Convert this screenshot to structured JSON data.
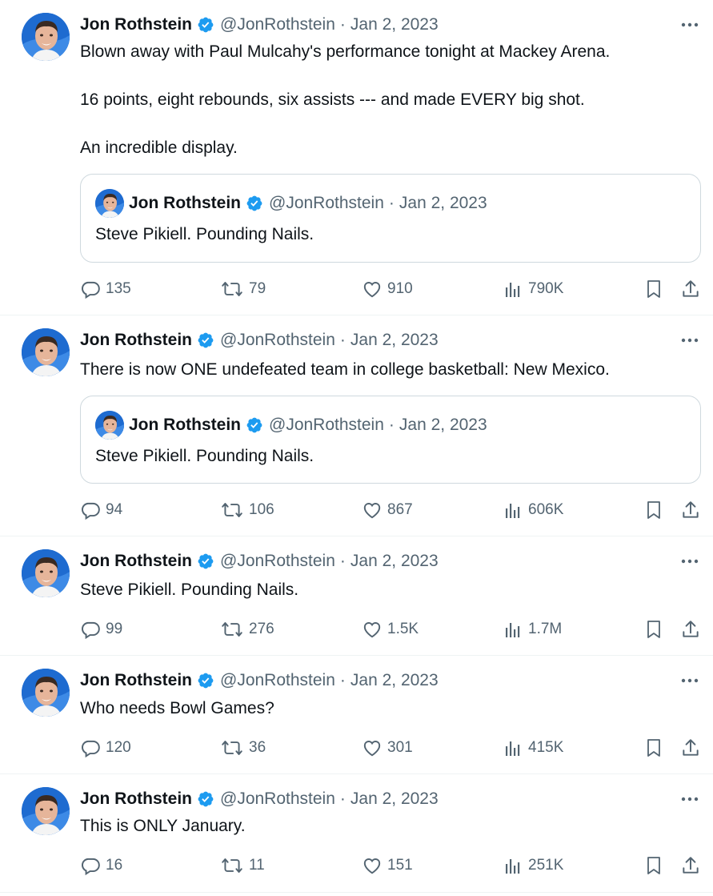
{
  "tweets": [
    {
      "name": "Jon Rothstein",
      "handle": "@JonRothstein",
      "dot": "·",
      "date": "Jan 2, 2023",
      "text": "Blown away with Paul Mulcahy's performance tonight at Mackey Arena.\n\n16 points, eight rebounds, six assists --- and made EVERY big shot.\n\nAn incredible display.",
      "quote": {
        "name": "Jon Rothstein",
        "handle": "@JonRothstein",
        "dot": "·",
        "date": "Jan 2, 2023",
        "text": "Steve Pikiell. Pounding Nails."
      },
      "replies": "135",
      "retweets": "79",
      "likes": "910",
      "views": "790K"
    },
    {
      "name": "Jon Rothstein",
      "handle": "@JonRothstein",
      "dot": "·",
      "date": "Jan 2, 2023",
      "text": "There is now ONE undefeated team in college basketball: New Mexico.",
      "quote": {
        "name": "Jon Rothstein",
        "handle": "@JonRothstein",
        "dot": "·",
        "date": "Jan 2, 2023",
        "text": "Steve Pikiell. Pounding Nails."
      },
      "replies": "94",
      "retweets": "106",
      "likes": "867",
      "views": "606K"
    },
    {
      "name": "Jon Rothstein",
      "handle": "@JonRothstein",
      "dot": "·",
      "date": "Jan 2, 2023",
      "text": "Steve Pikiell. Pounding Nails.",
      "replies": "99",
      "retweets": "276",
      "likes": "1.5K",
      "views": "1.7M"
    },
    {
      "name": "Jon Rothstein",
      "handle": "@JonRothstein",
      "dot": "·",
      "date": "Jan 2, 2023",
      "text": "Who needs Bowl Games?",
      "replies": "120",
      "retweets": "36",
      "likes": "301",
      "views": "415K"
    },
    {
      "name": "Jon Rothstein",
      "handle": "@JonRothstein",
      "dot": "·",
      "date": "Jan 2, 2023",
      "text": "This is ONLY January.",
      "replies": "16",
      "retweets": "11",
      "likes": "151",
      "views": "251K"
    }
  ],
  "colors": {
    "verified": "#1d9bf0",
    "secondary_text": "#536471",
    "border": "#cfd9de"
  },
  "icons": [
    "verified-badge-icon",
    "more-icon",
    "reply-icon",
    "retweet-icon",
    "like-icon",
    "views-icon",
    "bookmark-icon",
    "share-icon"
  ]
}
